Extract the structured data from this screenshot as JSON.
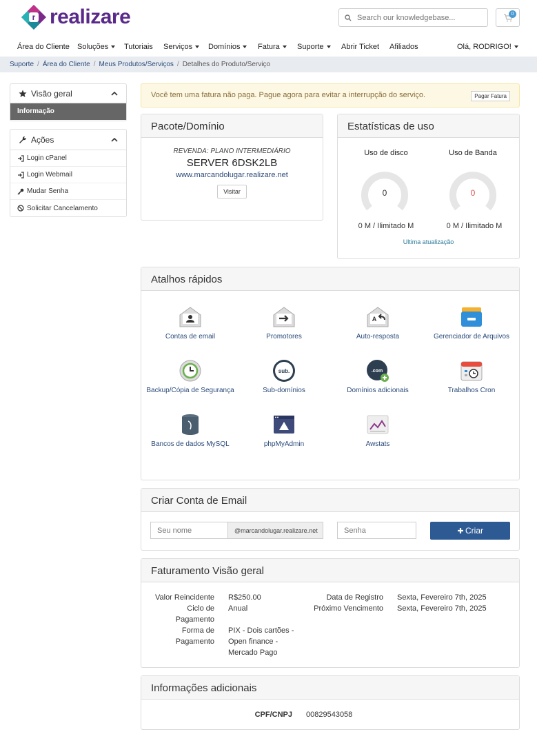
{
  "brand": {
    "name": "realizare",
    "mark_letter": "r"
  },
  "search": {
    "placeholder": "Search our knowledgebase..."
  },
  "cart": {
    "count": "0"
  },
  "nav": {
    "items": [
      "Área do Cliente",
      "Soluções",
      "Tutoriais",
      "Serviços",
      "Domínios",
      "Fatura",
      "Suporte",
      "Abrir Ticket",
      "Afiliados"
    ],
    "user": "Olá, RODRIGO!"
  },
  "breadcrumb": [
    "Suporte",
    "Área do Cliente",
    "Meus Produtos/Serviços",
    "Detalhes do Produto/Serviço"
  ],
  "sidebar": {
    "overview": {
      "title": "Visão geral",
      "active": "Informação"
    },
    "actions": {
      "title": "Ações",
      "items": [
        "Login cPanel",
        "Login Webmail",
        "Mudar Senha",
        "Solicitar Cancelamento"
      ]
    }
  },
  "alert": {
    "text": "Você tem uma fatura não paga. Pague agora para evitar a interrupção do serviço.",
    "button": "Pagar Fatura"
  },
  "package": {
    "title": "Pacote/Domínio",
    "plan": "REVENDA: PLANO INTERMEDIÁRIO",
    "server": "SERVER 6DSK2LB",
    "domain": "www.marcandolugar.realizare.net",
    "visit": "Visitar"
  },
  "usage": {
    "title": "Estatísticas de uso",
    "disk": {
      "label": "Uso de disco",
      "value": "0",
      "detail": "0 M / Ilimitado M",
      "fraction": 0,
      "color": "#333333"
    },
    "band": {
      "label": "Uso de Banda",
      "value": "0",
      "detail": "0 M / Ilimitado M",
      "fraction": 0,
      "color": "#d9534f"
    },
    "updated": "Ultima atualização"
  },
  "shortcuts": {
    "title": "Atalhos rápidos",
    "items": [
      {
        "label": "Contas de email",
        "icon": "email-accounts-icon"
      },
      {
        "label": "Promotores",
        "icon": "forwarders-icon"
      },
      {
        "label": "Auto-resposta",
        "icon": "autoresponder-icon"
      },
      {
        "label": "Gerenciador de Arquivos",
        "icon": "file-manager-icon"
      },
      {
        "label": "Backup/Cópia de Segurança",
        "icon": "backup-icon"
      },
      {
        "label": "Sub-domínios",
        "icon": "subdomains-icon"
      },
      {
        "label": "Domínios adicionais",
        "icon": "addon-domains-icon"
      },
      {
        "label": "Trabalhos Cron",
        "icon": "cron-jobs-icon"
      },
      {
        "label": "Bancos de dados MySQL",
        "icon": "mysql-icon"
      },
      {
        "label": "phpMyAdmin",
        "icon": "phpmyadmin-icon"
      },
      {
        "label": "Awstats",
        "icon": "awstats-icon"
      }
    ]
  },
  "email_create": {
    "title": "Criar Conta de Email",
    "name_placeholder": "Seu nome",
    "domain_suffix": "@marcandolugar.realizare.net",
    "password_placeholder": "Senha",
    "button": "Criar"
  },
  "billing": {
    "title": "Faturamento Visão geral",
    "left": [
      {
        "label": "Valor Reincidente",
        "value": "R$250.00"
      },
      {
        "label": "Ciclo de Pagamento",
        "value": "Anual"
      },
      {
        "label": "Forma de Pagamento",
        "value": "PIX - Dois cartões - Open finance - Mercado Pago"
      }
    ],
    "right": [
      {
        "label": "Data de Registro",
        "value": "Sexta, Fevereiro 7th, 2025"
      },
      {
        "label": "Próximo Vencimento",
        "value": "Sexta, Fevereiro 7th, 2025"
      }
    ]
  },
  "extra": {
    "title": "Informações adicionais",
    "label": "CPF/CNPJ",
    "value": "00829543058"
  },
  "colors": {
    "brand": "#5a2a8a",
    "link": "#2a4a7a",
    "primary_button": "#2e5a94",
    "alert_bg": "#fcf8e3",
    "panel_header": "#f6f6f6"
  }
}
